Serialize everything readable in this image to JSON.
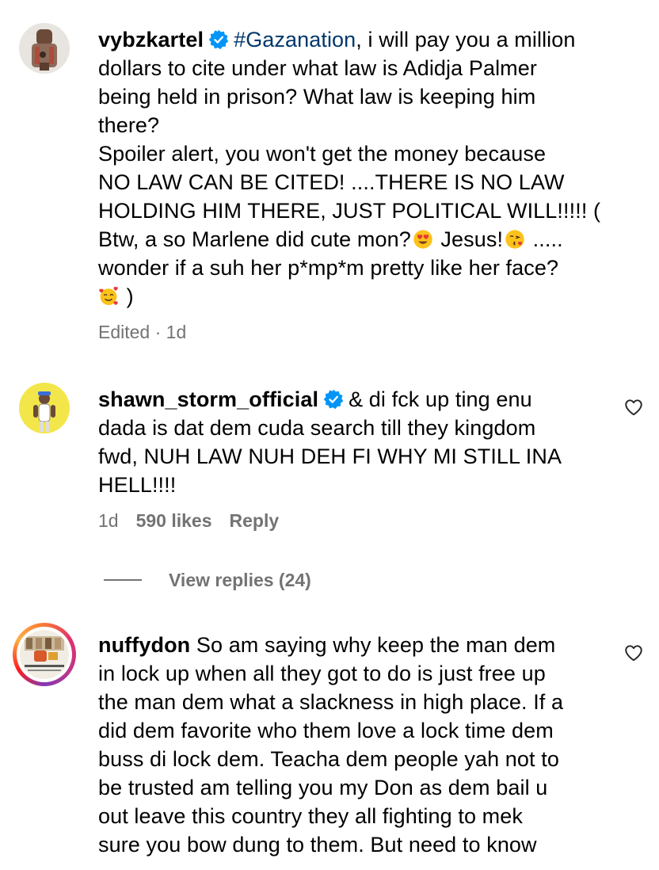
{
  "comments": [
    {
      "username": "vybzkartel",
      "verified": true,
      "hashtag": "#Gazanation",
      "lines": [
        ", i will pay you a million",
        "dollars to cite under what law is Adidja Palmer",
        "being held in prison? What law is keeping him",
        "there?",
        "Spoiler alert, you won't get the money because",
        "NO LAW CAN BE CITED! ....THERE IS NO LAW",
        "HOLDING HIM THERE, JUST POLITICAL WILL!!!!! (",
        "Btw, a so Marlene did cute mon?",
        " Jesus!",
        " .....",
        "wonder if a suh her p*mp*m pretty like her face?",
        " )"
      ],
      "emojis": [
        "heart-eyes-emoji",
        "kissing-heart-emoji",
        "smiling-hearts-emoji"
      ],
      "meta": "Edited · 1d"
    },
    {
      "username": "shawn_storm_official",
      "verified": true,
      "lines": [
        "& di fck up ting enu",
        "dada is dat dem cuda search till they kingdom",
        "fwd, NUH LAW NUH DEH FI WHY MI STILL INA",
        "HELL!!!!"
      ],
      "time": "1d",
      "likes": "590 likes",
      "reply_label": "Reply"
    },
    {
      "username": "nuffydon",
      "verified": false,
      "lines": [
        " So am saying why keep the man dem",
        "in lock up when all they got to do is just free up",
        "the man dem what a slackness in high place. If a",
        "did dem favorite who them love a lock time dem",
        "buss di lock dem. Teacha dem people yah not to",
        "be trusted am telling you my Don as dem bail u",
        "out leave this country they all fighting to mek",
        "sure you bow dung to them. But need to know"
      ]
    }
  ],
  "view_replies": "View replies (24)",
  "colors": {
    "text": "#000000",
    "secondary": "#737373",
    "hashtag": "#00376b",
    "verified": "#0095f6"
  }
}
